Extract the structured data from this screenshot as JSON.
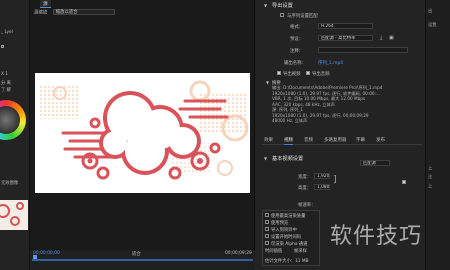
{
  "left_panel": {
    "rows": [
      "_ Lyel",
      "",
      "X 1",
      "分 离",
      "了 解",
      "",
      "",
      "",
      "",
      "",
      "无效图像"
    ],
    "wheel_label": "色轮"
  },
  "source": {
    "tab_label": "源",
    "select_label": "源缩放",
    "select_value": "缩放以适合"
  },
  "timeline": {
    "current_time": "00;00;00;00",
    "range_label": "适合",
    "end_time": "00;00;09;29"
  },
  "export": {
    "section_title": "导出设置",
    "match_sequence": "与序列设置匹配",
    "format_label": "格式：",
    "format_value": "H.264",
    "preset_label": "预设：",
    "preset_value": "匹配源 - 高比特率",
    "comment_label": "注释：",
    "output_label": "输出名称：",
    "output_value": "序列_1.mp4",
    "export_video": "导出视频",
    "export_audio": "导出音频",
    "summary_title": "摘要",
    "summary_text": "输出: D:\\Documents\\Adobe\\Premiere Pro\\\\序列_1.mp4\n1920x1080 (1.0), 29.97 fps, 逐行, 软件编码, 00:00:...\nVBR, 1 次, 目标 10.00 Mbps, 最大 12.00 Mbps\nAAC, 320 kbps, 48 kHz, 立体声\n源: 序列, 序列_1\n1920x1080 (1.0), 29.97 fps, 逐行, 00;00;09;29\n48000 Hz, 立体声",
    "tabs": [
      "效果",
      "视频",
      "音频",
      "多路复用器",
      "字幕",
      "发布"
    ],
    "basic_video": "基本视频设置",
    "match_source_btn": "匹配源",
    "width_label": "宽度：",
    "height_label": "高度：",
    "width_value": "1,920",
    "height_value": "1,080",
    "frame_rate_label": "帧速率："
  },
  "bottom_options": {
    "rows": [
      "使用最高渲染质量",
      "使用预览",
      "导入到项目中",
      "设置开始时间码",
      "仅渲染 Alpha 通道",
      "时间插值",
      "帧采样",
      "估计文件大小：11 MB"
    ]
  },
  "right_strip": {
    "rows": [
      "出",
      "设置",
      "",
      "",
      "",
      "",
      "",
      "上",
      "注",
      "上"
    ]
  },
  "watermark": "软件技巧"
}
